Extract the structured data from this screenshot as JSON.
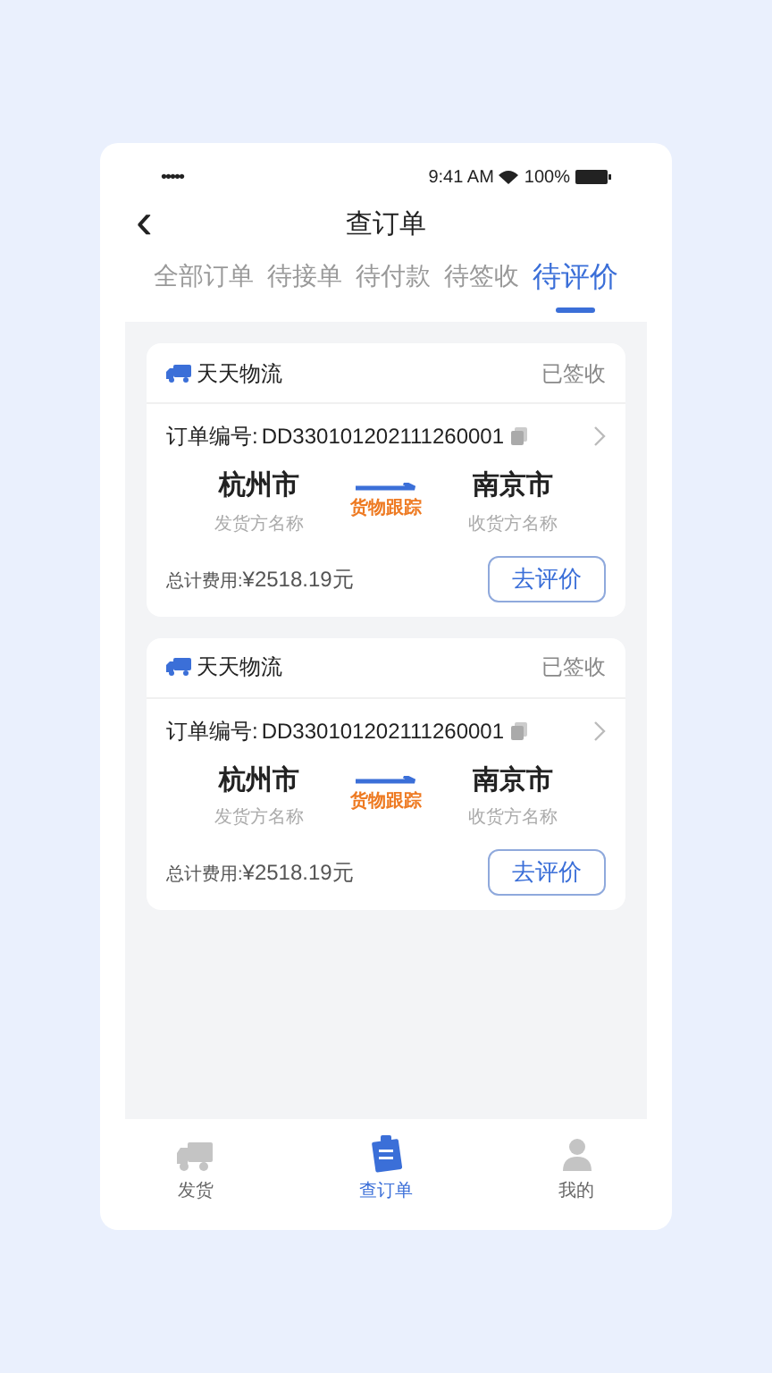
{
  "status_bar": {
    "signal": "•••••",
    "time": "9:41 AM",
    "battery": "100%"
  },
  "header": {
    "back": "‹",
    "title": "查订单"
  },
  "tabs": [
    {
      "label": "全部订单",
      "selected": false
    },
    {
      "label": "待接单",
      "selected": false
    },
    {
      "label": "待付款",
      "selected": false
    },
    {
      "label": "待签收",
      "selected": false
    },
    {
      "label": "待评价",
      "selected": true
    }
  ],
  "orders": [
    {
      "company": "天天物流",
      "status": "已签收",
      "order_label": "订单编号:",
      "order_no": "DD330101202111260001",
      "from_city": "杭州市",
      "from_label": "发货方名称",
      "track": "货物跟踪",
      "to_city": "南京市",
      "to_label": "收货方名称",
      "total_label": "总计费用:",
      "total": "¥2518.19元",
      "action": "去评价"
    },
    {
      "company": "天天物流",
      "status": "已签收",
      "order_label": "订单编号:",
      "order_no": "DD330101202111260001",
      "from_city": "杭州市",
      "from_label": "发货方名称",
      "track": "货物跟踪",
      "to_city": "南京市",
      "to_label": "收货方名称",
      "total_label": "总计费用:",
      "total": "¥2518.19元",
      "action": "去评价"
    }
  ],
  "bottom_nav": [
    {
      "kind": "truck",
      "label": "发货",
      "selected": false
    },
    {
      "kind": "clipboard",
      "label": "查订单",
      "selected": true
    },
    {
      "kind": "person",
      "label": "我的",
      "selected": false
    }
  ]
}
